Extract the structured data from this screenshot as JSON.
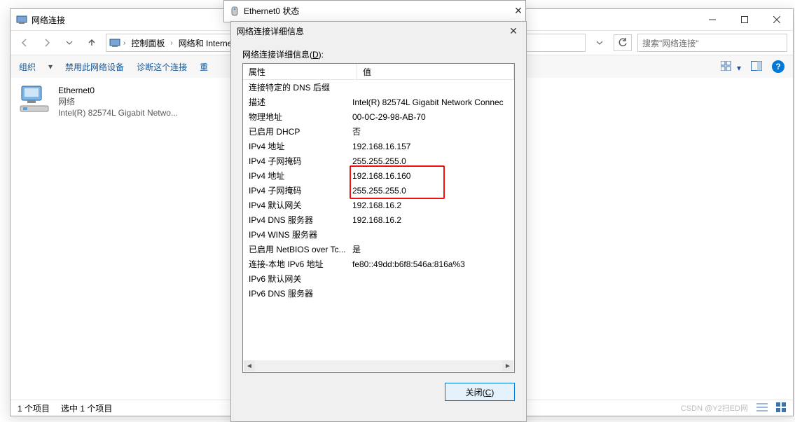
{
  "explorer": {
    "title": "网络连接",
    "nav": {
      "back": "←",
      "forward": "→",
      "up": "↑"
    },
    "breadcrumb": [
      "控制面板",
      "网络和 Internet"
    ],
    "search_placeholder": "搜索\"网络连接\"",
    "toolbar": {
      "org": "组织",
      "disable": "禁用此网络设备",
      "diagnose": "诊断这个连接",
      "rename": "重"
    },
    "item": {
      "name": "Ethernet0",
      "status": "网络",
      "adapter": "Intel(R) 82574L Gigabit Netwo..."
    },
    "statusbar": {
      "count": "1 个项目",
      "selected": "选中 1 个项目"
    },
    "watermark": "CSDN @Y2扫ED网"
  },
  "status_dialog": {
    "title": "Ethernet0 状态"
  },
  "details_dialog": {
    "title": "网络连接详细信息",
    "label_pre": "网络连接详细信息(",
    "label_u": "D",
    "label_post": "):",
    "header": {
      "prop": "属性",
      "val": "值"
    },
    "rows": [
      {
        "p": "连接特定的 DNS 后缀",
        "v": ""
      },
      {
        "p": "描述",
        "v": "Intel(R) 82574L Gigabit Network Connec"
      },
      {
        "p": "物理地址",
        "v": "00-0C-29-98-AB-70"
      },
      {
        "p": "已启用 DHCP",
        "v": "否"
      },
      {
        "p": "IPv4 地址",
        "v": "192.168.16.157"
      },
      {
        "p": "IPv4 子网掩码",
        "v": "255.255.255.0"
      },
      {
        "p": "IPv4 地址",
        "v": "192.168.16.160"
      },
      {
        "p": "IPv4 子网掩码",
        "v": "255.255.255.0"
      },
      {
        "p": "IPv4 默认网关",
        "v": "192.168.16.2"
      },
      {
        "p": "IPv4 DNS 服务器",
        "v": "192.168.16.2"
      },
      {
        "p": "IPv4 WINS 服务器",
        "v": ""
      },
      {
        "p": "已启用 NetBIOS over Tc...",
        "v": "是"
      },
      {
        "p": "连接-本地 IPv6 地址",
        "v": "fe80::49dd:b6f8:546a:816a%3"
      },
      {
        "p": "IPv6 默认网关",
        "v": ""
      },
      {
        "p": "IPv6 DNS 服务器",
        "v": ""
      }
    ],
    "close_btn": "关闭(C)"
  }
}
